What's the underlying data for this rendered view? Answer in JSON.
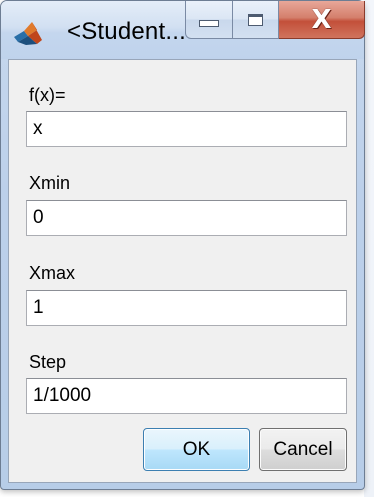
{
  "window": {
    "title": "<Student..."
  },
  "fields": [
    {
      "label": "f(x)=",
      "value": "x"
    },
    {
      "label": "Xmin",
      "value": "0"
    },
    {
      "label": "Xmax",
      "value": "1"
    },
    {
      "label": "Step",
      "value": "1/1000"
    }
  ],
  "buttons": {
    "ok_label": "OK",
    "cancel_label": "Cancel"
  },
  "controls": {
    "close_glyph": "X"
  },
  "colors": {
    "accent_ok_border": "#3c7fb1",
    "close_button": "#c3503a",
    "frame": "#bcd0ea"
  },
  "icons": {
    "app": "matlab-logo-icon",
    "minimize": "minimize-icon",
    "maximize": "maximize-icon",
    "close": "close-icon"
  }
}
